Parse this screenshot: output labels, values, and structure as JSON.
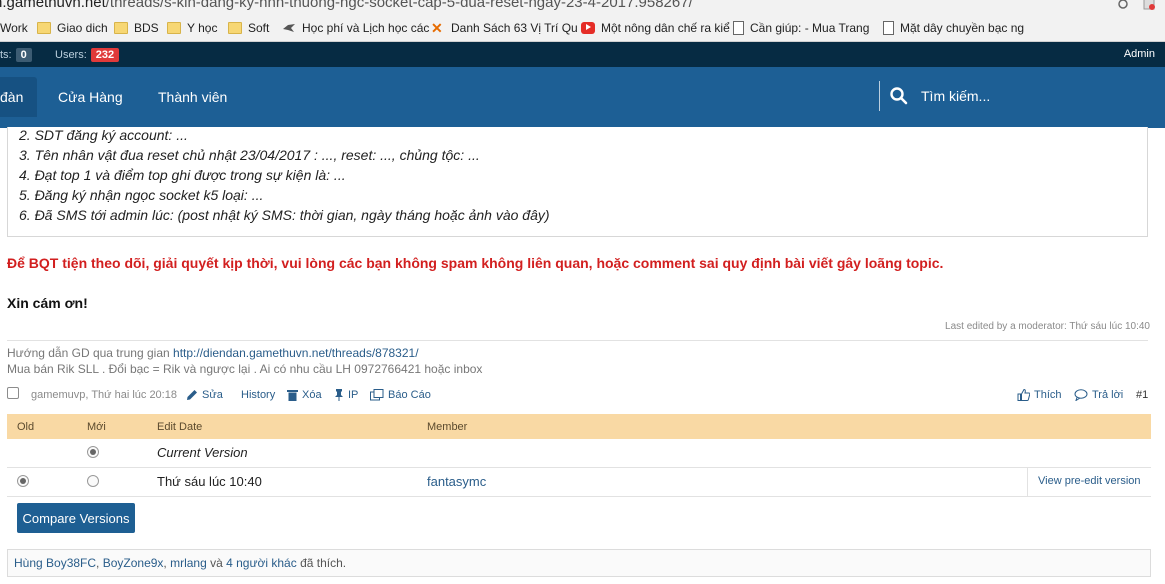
{
  "browser": {
    "url_host": "n.gamethuvn.net",
    "url_path": "/threads/s-kin-dang-ky-nnn-thuong-ngc-socket-cap-5-dua-reset-ngay-23-4-2017.958267/",
    "bookmarks": [
      {
        "label": "Work",
        "icon": "folder-icon"
      },
      {
        "label": "Giao dich",
        "icon": "folder-icon"
      },
      {
        "label": "BDS",
        "icon": "folder-icon"
      },
      {
        "label": "Y học",
        "icon": "folder-icon"
      },
      {
        "label": "Soft",
        "icon": "folder-icon"
      },
      {
        "label": "Học phí và Lịch học các",
        "icon": "bird-icon"
      },
      {
        "label": "Danh Sách 63 Vị Trí Qu",
        "icon": "x-logo-icon"
      },
      {
        "label": "Một nông dân chế ra kiể",
        "icon": "youtube-icon"
      },
      {
        "label": "Cần giúp: - Mua Trang",
        "icon": "page-icon"
      },
      {
        "label": "Mặt dây chuyền bạc ng",
        "icon": "page-icon"
      }
    ]
  },
  "topbar": {
    "posts_label": "ts:",
    "posts_count": "0",
    "users_label": "Users:",
    "users_count": "232",
    "admin": "Admin"
  },
  "nav": {
    "tabs": [
      {
        "label": "đàn",
        "active": true
      },
      {
        "label": "Cửa Hàng",
        "active": false
      },
      {
        "label": "Thành viên",
        "active": false
      }
    ],
    "search_label": "Tìm kiếm..."
  },
  "post": {
    "lines": [
      "2. SDT đăng ký account: ...",
      "3. Tên nhân vật đua reset chủ nhật 23/04/2017 : ..., reset: ..., chủng tộc: ...",
      "4. Đạt top 1 và điểm top ghi được trong sự kiện là: ...",
      "5. Đăng ký nhận ngọc socket k5 loại: ...",
      "6. Đã SMS tới admin lúc: (post nhật ký SMS: thời gian, ngày tháng hoặc ảnh vào đây)"
    ],
    "notice": "Để BQT tiện theo dõi, giải quyết kịp thời, vui lòng các bạn không spam không liên quan, hoặc comment sai quy định bài viết gây loãng topic.",
    "thanks": "Xin cám ơn!",
    "last_edited": "Last edited by a moderator: Thứ sáu lúc 10:40",
    "signature": {
      "line1_prefix": "Hướng dẫn GD qua trung gian ",
      "line1_link": "http://diendan.gamethuvn.net/threads/878321/",
      "line2": "Mua bán Rik SLL . Đổi bạc = Rik và ngược lại . Ai có nhu cầu LH 0972766421 hoặc inbox"
    }
  },
  "meta": {
    "author_time": "gamemuvp, Thứ hai lúc 20:18",
    "edit": "Sửa",
    "history": "History",
    "delete": "Xóa",
    "ip": "IP",
    "report": "Báo Cáo",
    "like": "Thích",
    "reply": "Trả lời",
    "post_number": "#1"
  },
  "history_table": {
    "headers": [
      "Old",
      "Mới",
      "Edit Date",
      "Member"
    ],
    "current_version": "Current Version",
    "rows": [
      {
        "date": "Thứ sáu lúc 10:40",
        "member": "fantasymc",
        "view": "View pre-edit version"
      }
    ],
    "compare_button": "Compare Versions"
  },
  "likes": {
    "users": [
      "Hùng Boy38FC",
      "BoyZone9x",
      "mrlang"
    ],
    "sep1": ", ",
    "sep2": ", ",
    "and": " và ",
    "others": "4 người khác",
    "suffix": " đã thích."
  },
  "colors": {
    "nav_bg": "#1d5f95",
    "topbar_bg": "#062b43",
    "notice_red": "#d21f1f",
    "table_head": "#f9d9a4",
    "users_badge": "#e03a3a"
  }
}
